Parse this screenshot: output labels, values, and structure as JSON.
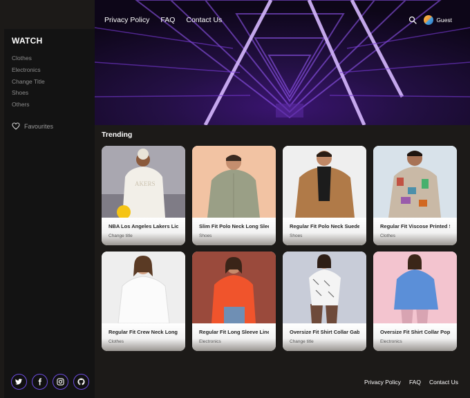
{
  "header": {
    "nav": [
      "Privacy Policy",
      "FAQ",
      "Contact Us"
    ],
    "user_label": "Guest",
    "icons": {
      "search": "search-icon",
      "avatar": "avatar"
    }
  },
  "sidebar": {
    "brand": "WATCH",
    "categories": [
      "Clothes",
      "Electronics",
      "Change Title",
      "Shoes",
      "Others"
    ],
    "favourites_label": "Favourites"
  },
  "trending": {
    "title": "Trending",
    "products": [
      {
        "title": "NBA Los Angeles Lakers Licen",
        "category": "Change title"
      },
      {
        "title": "Slim Fit Polo Neck Long Sleeve",
        "category": "Shoes"
      },
      {
        "title": "Regular Fit Polo Neck Suede Lo",
        "category": "Shoes"
      },
      {
        "title": "Regular Fit Viscose Printed Sh",
        "category": "Clothes"
      },
      {
        "title": "Regular Fit Crew Neck Long Sl",
        "category": "Clothes"
      },
      {
        "title": "Regular Fit Long Sleeve Linen",
        "category": "Electronics"
      },
      {
        "title": "Oversize Fit Shirt Collar Gabar",
        "category": "Change title"
      },
      {
        "title": "Oversize Fit Shirt Collar Poplin",
        "category": "Electronics"
      }
    ]
  },
  "footer": {
    "links": [
      "Privacy Policy",
      "FAQ",
      "Contact Us"
    ],
    "social": [
      "twitter-icon",
      "facebook-icon",
      "instagram-icon",
      "github-icon"
    ]
  },
  "colors": {
    "accent": "#6c4ce0",
    "hero_purple": "#8a3cff",
    "sidebar_bg": "#131313",
    "page_bg": "#1c1a18"
  }
}
